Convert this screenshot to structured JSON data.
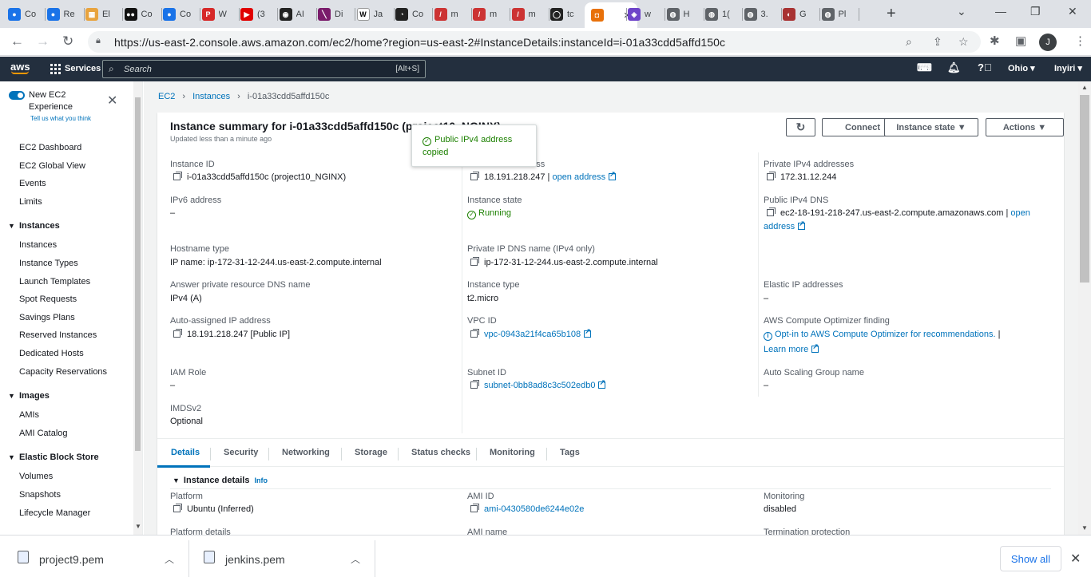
{
  "browser": {
    "tabs": [
      {
        "title": "Co",
        "color": "#1a73e8",
        "glyph": "●"
      },
      {
        "title": "Re",
        "color": "#1a73e8",
        "glyph": "●"
      },
      {
        "title": "El",
        "color": "#e8a33d",
        "glyph": "▦"
      },
      {
        "title": "Co",
        "color": "#111111",
        "glyph": "●●"
      },
      {
        "title": "Co",
        "color": "#1a73e8",
        "glyph": "●"
      },
      {
        "title": "W",
        "color": "#d62828",
        "glyph": "P"
      },
      {
        "title": "(3",
        "color": "#e00000",
        "glyph": "▶"
      },
      {
        "title": "AI",
        "color": "#222222",
        "glyph": "◉"
      },
      {
        "title": "Di",
        "color": "#7a1b6b",
        "glyph": "╲"
      },
      {
        "title": "Ja",
        "color": "#ffffff",
        "glyph": "W"
      },
      {
        "title": "Co",
        "color": "#222222",
        "glyph": "◔"
      },
      {
        "title": "m",
        "color": "#cc3333",
        "glyph": "/"
      },
      {
        "title": "m",
        "color": "#cc3333",
        "glyph": "/"
      },
      {
        "title": "m",
        "color": "#cc3333",
        "glyph": "/"
      },
      {
        "title": "tc",
        "color": "#222222",
        "glyph": "◯"
      },
      {
        "title": "",
        "color": "#e8710a",
        "glyph": "◘",
        "active": true
      },
      {
        "title": "w",
        "color": "#6e44c9",
        "glyph": "◈"
      },
      {
        "title": "H",
        "color": "#5f6368",
        "glyph": "◍"
      },
      {
        "title": "1(",
        "color": "#5f6368",
        "glyph": "◍"
      },
      {
        "title": "3.",
        "color": "#5f6368",
        "glyph": "◍"
      },
      {
        "title": "G",
        "color": "#a83232",
        "glyph": "◐"
      },
      {
        "title": "Pl",
        "color": "#5f6368",
        "glyph": "◍"
      }
    ],
    "url": "https://us-east-2.console.aws.amazon.com/ec2/home?region=us-east-2#InstanceDetails:instanceId=i-01a33cdd5affd150c",
    "profile_initial": "J"
  },
  "aws_nav": {
    "logo": "aws",
    "services_label": "Services",
    "search_placeholder": "Search",
    "search_shortcut": "[Alt+S]",
    "region": "Ohio ▾",
    "user": "Inyiri ▾"
  },
  "sidebar": {
    "new_experience": "New EC2 Experience",
    "tell_us": "Tell us what you think",
    "top_items": [
      "EC2 Dashboard",
      "EC2 Global View",
      "Events",
      "Limits"
    ],
    "sections": [
      {
        "title": "Instances",
        "items": [
          "Instances",
          "Instance Types",
          "Launch Templates",
          "Spot Requests",
          "Savings Plans",
          "Reserved Instances",
          "Dedicated Hosts",
          "Capacity Reservations"
        ]
      },
      {
        "title": "Images",
        "items": [
          "AMIs",
          "AMI Catalog"
        ]
      },
      {
        "title": "Elastic Block Store",
        "items": [
          "Volumes",
          "Snapshots",
          "Lifecycle Manager"
        ]
      }
    ]
  },
  "breadcrumb": {
    "items": [
      "EC2",
      "Instances",
      "i-01a33cdd5affd150c"
    ]
  },
  "summary": {
    "title": "Instance summary for i-01a33cdd5affd150c (project10_NGINX)",
    "updated": "Updated less than a minute ago",
    "buttons": {
      "refresh": "↻",
      "connect": "Connect",
      "instance_state": "Instance state ▼",
      "actions": "Actions ▼"
    },
    "tooltip": "Public IPv4 address copied",
    "fields": {
      "instance_id": {
        "label": "Instance ID",
        "value": "i-01a33cdd5affd150c (project10_NGINX)"
      },
      "public_ipv4": {
        "label": "Public IPv4 address",
        "value": "18.191.218.247 |",
        "link": "open address"
      },
      "private_ipv4": {
        "label": "Private IPv4 addresses",
        "value": "172.31.12.244"
      },
      "ipv6": {
        "label": "IPv6 address",
        "value": "–"
      },
      "instance_state": {
        "label": "Instance state",
        "value": "Running"
      },
      "public_dns": {
        "label": "Public IPv4 DNS",
        "value": "ec2-18-191-218-247.us-east-2.compute.amazonaws.com |",
        "link_a": "open",
        "link_b": "address"
      },
      "hostname_type": {
        "label": "Hostname type",
        "value": "IP name: ip-172-31-12-244.us-east-2.compute.internal"
      },
      "private_dns": {
        "label": "Private IP DNS name (IPv4 only)",
        "value": "ip-172-31-12-244.us-east-2.compute.internal"
      },
      "answer_dns": {
        "label": "Answer private resource DNS name",
        "value": "IPv4 (A)"
      },
      "instance_type": {
        "label": "Instance type",
        "value": "t2.micro"
      },
      "elastic_ip": {
        "label": "Elastic IP addresses",
        "value": "–"
      },
      "auto_ip": {
        "label": "Auto-assigned IP address",
        "value": "18.191.218.247 [Public IP]"
      },
      "vpc_id": {
        "label": "VPC ID",
        "value": "vpc-0943a21f4ca65b108"
      },
      "optimizer": {
        "label": "AWS Compute Optimizer finding",
        "value": "Opt-in to AWS Compute Optimizer for recommendations.",
        "sep": "|",
        "learn_more": "Learn more"
      },
      "iam_role": {
        "label": "IAM Role",
        "value": "–"
      },
      "subnet_id": {
        "label": "Subnet ID",
        "value": "subnet-0bb8ad8c3c502edb0"
      },
      "asg_name": {
        "label": "Auto Scaling Group name",
        "value": "–"
      },
      "imdsv2": {
        "label": "IMDSv2",
        "value": "Optional"
      }
    }
  },
  "detail_tabs": [
    "Details",
    "Security",
    "Networking",
    "Storage",
    "Status checks",
    "Monitoring",
    "Tags"
  ],
  "instance_details": {
    "title": "Instance details",
    "info": "Info",
    "platform": {
      "label": "Platform",
      "value": "Ubuntu (Inferred)"
    },
    "ami_id": {
      "label": "AMI ID",
      "value": "ami-0430580de6244e02e"
    },
    "monitoring": {
      "label": "Monitoring",
      "value": "disabled"
    },
    "platform_details": {
      "label": "Platform details"
    },
    "ami_name": {
      "label": "AMI name"
    },
    "termination": {
      "label": "Termination protection"
    }
  },
  "downloads": {
    "items": [
      "project9.pem",
      "jenkins.pem"
    ],
    "show_all": "Show all"
  }
}
